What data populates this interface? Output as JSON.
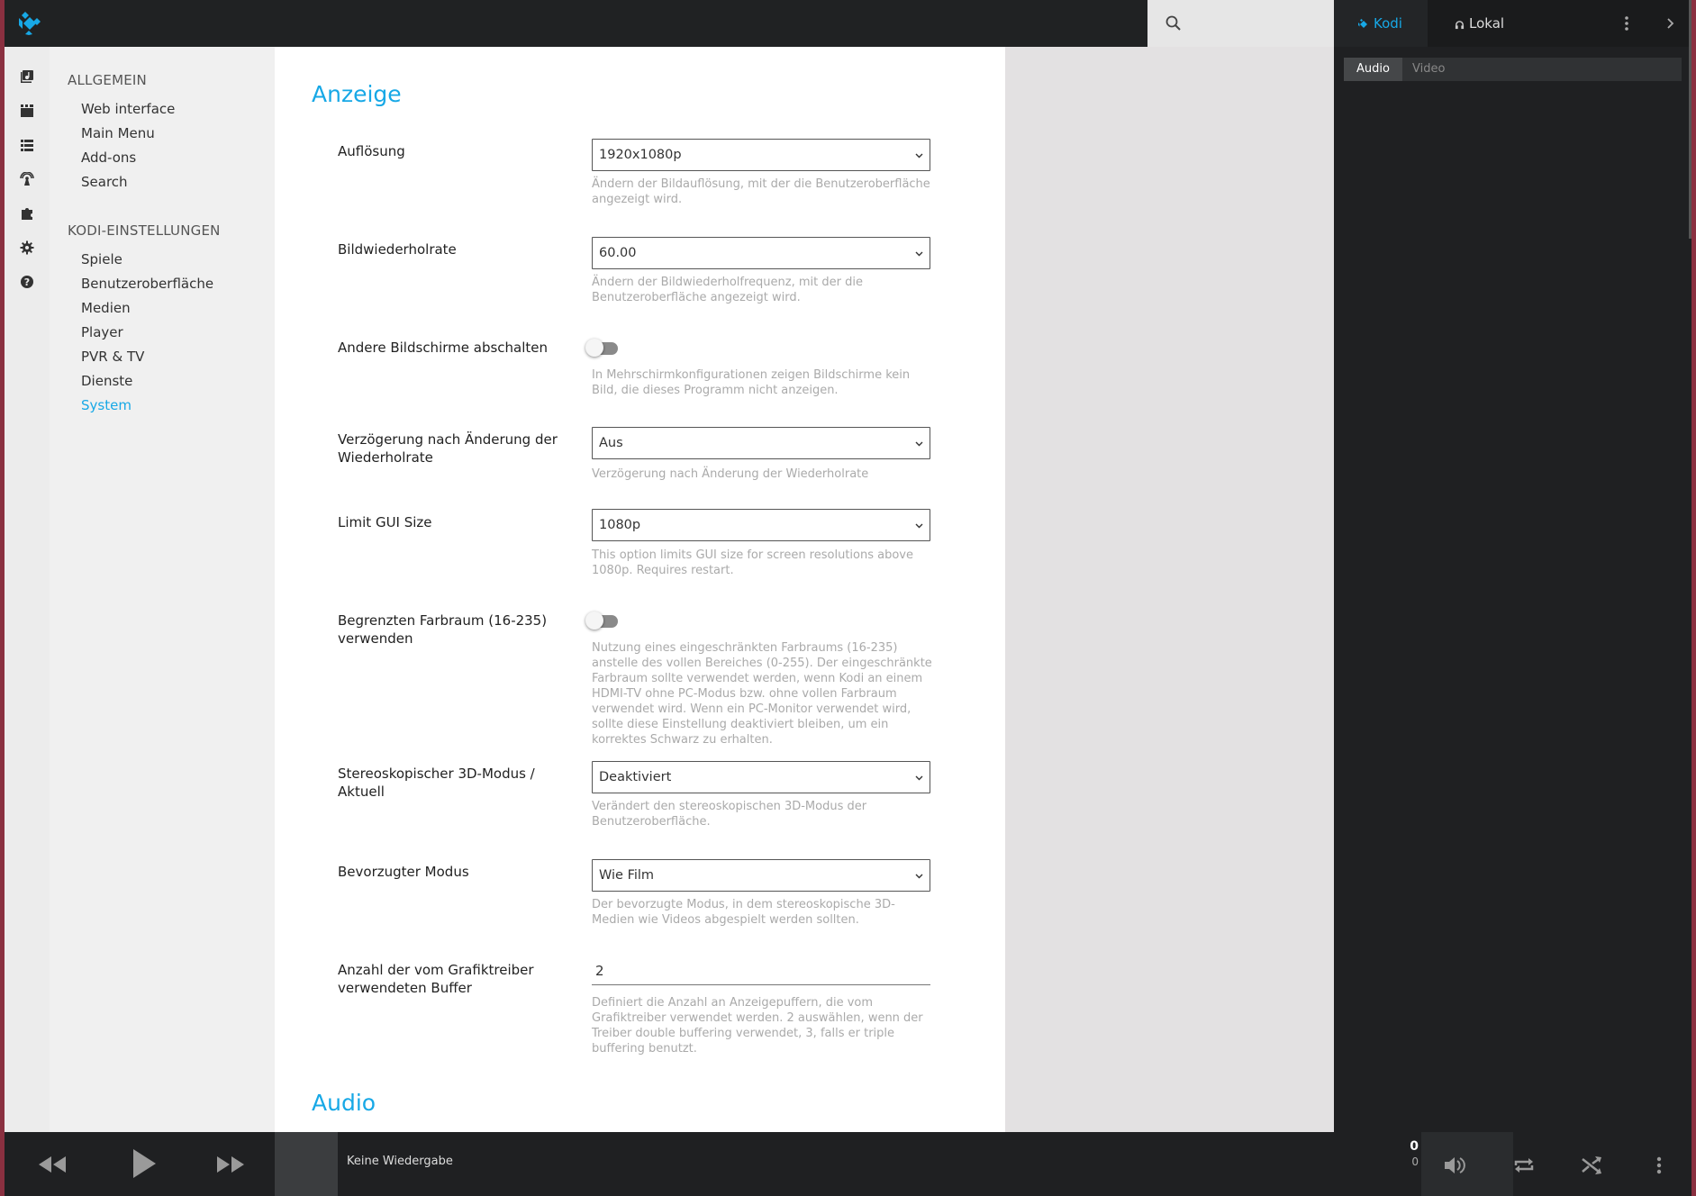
{
  "search": {
    "placeholder": ""
  },
  "nav": {
    "section1": "ALLGEMEIN",
    "section1_items": [
      "Web interface",
      "Main Menu",
      "Add-ons",
      "Search"
    ],
    "section2": "KODI-EINSTELLUNGEN",
    "section2_items": [
      "Spiele",
      "Benutzeroberfläche",
      "Medien",
      "Player",
      "PVR & TV",
      "Dienste",
      "System"
    ],
    "active_item": "System"
  },
  "main": {
    "section_title": "Anzeige",
    "next_section_title": "Audio",
    "settings": [
      {
        "label": "Auflösung",
        "value": "1920x1080p",
        "desc": "Ändern der Bildauflösung, mit der die Benutzeroberfläche angezeigt wird."
      },
      {
        "label": "Bildwiederholrate",
        "value": "60.00",
        "desc": "Ändern der Bildwiederholfrequenz, mit der die Benutzeroberfläche angezeigt wird."
      },
      {
        "label": "Andere Bildschirme abschalten",
        "value": "off",
        "desc": "In Mehrschirmkonfigurationen zeigen Bildschirme kein Bild, die dieses Programm nicht anzeigen."
      },
      {
        "label": "Verzögerung nach Änderung der Wiederholrate",
        "value": "Aus",
        "desc": "Verzögerung nach Änderung der Wiederholrate"
      },
      {
        "label": "Limit GUI Size",
        "value": "1080p",
        "desc": "This option limits GUI size for screen resolutions above 1080p. Requires restart."
      },
      {
        "label": "Begrenzten Farbraum (16-235) verwenden",
        "value": "off",
        "desc": "Nutzung eines eingeschränkten Farbraums (16-235) anstelle des vollen Bereiches (0-255). Der eingeschränkte Farbraum sollte verwendet werden, wenn Kodi an einem HDMI-TV ohne PC-Modus bzw. ohne vollen Farbraum verwendet wird. Wenn ein PC-Monitor verwendet wird, sollte diese Einstellung deaktiviert bleiben, um ein korrektes Schwarz zu erhalten."
      },
      {
        "label": "Stereoskopischer 3D-Modus / Aktuell",
        "value": "Deaktiviert",
        "desc": "Verändert den stereoskopischen 3D-Modus der Benutzeroberfläche."
      },
      {
        "label": "Bevorzugter Modus",
        "value": "Wie Film",
        "desc": "Der bevorzugte Modus, in dem stereoskopische 3D-Medien wie Videos abgespielt werden sollten."
      },
      {
        "label": "Anzahl der vom Grafiktreiber verwendeten Buffer",
        "value": "2",
        "desc": "Definiert die Anzahl an Anzeigepuffern, die vom Grafiktreiber verwendet werden. 2 auswählen, wenn der Treiber double buffering verwendet, 3, falls er triple buffering benutzt."
      }
    ]
  },
  "right_panel": {
    "tabs": [
      "Kodi",
      "Lokal"
    ],
    "active_tab": "Kodi",
    "subtabs": [
      "Audio",
      "Video"
    ],
    "active_subtab": "Audio"
  },
  "player": {
    "now_playing": "Keine Wiedergabe",
    "time_current": "0",
    "time_total": "0"
  },
  "colors": {
    "accent": "#17a8e6",
    "dark": "#1f2022"
  }
}
